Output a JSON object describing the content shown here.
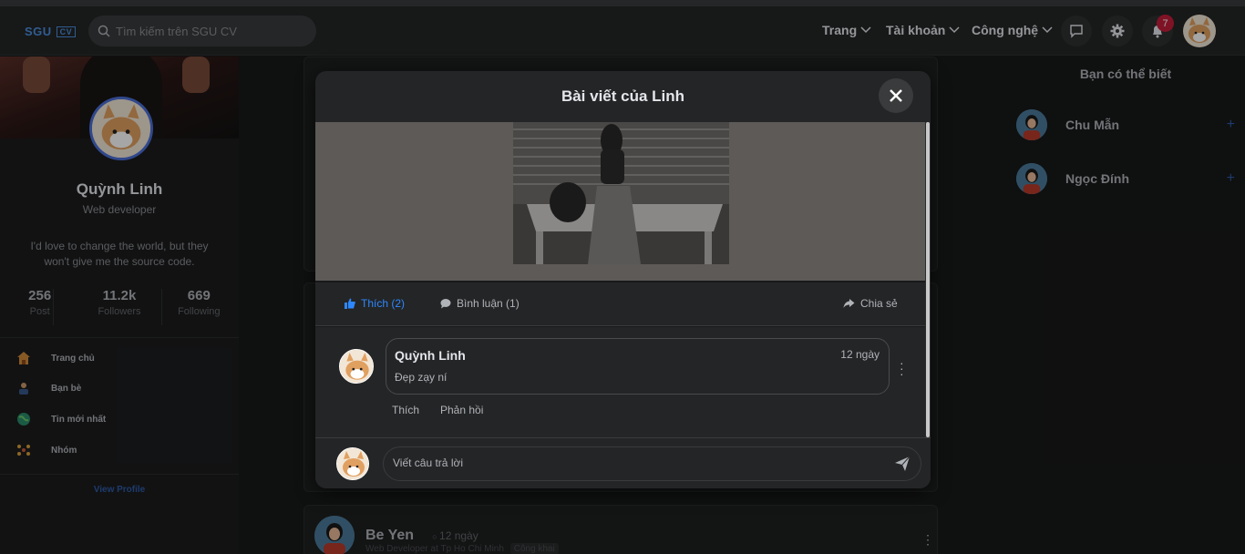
{
  "app": {
    "logo_main": "SGU",
    "logo_badge": "CV"
  },
  "search": {
    "placeholder": "Tìm kiếm trên SGU CV"
  },
  "nav": {
    "menus": [
      {
        "label": "Trang"
      },
      {
        "label": "Tài khoản"
      },
      {
        "label": "Công nghệ"
      }
    ],
    "notification_count": "7"
  },
  "profile": {
    "name": "Quỳnh Linh",
    "role": "Web developer",
    "bio": "I'd love to change the world, but they won't give me the source code.",
    "stats": [
      {
        "value": "256",
        "label": "Post"
      },
      {
        "value": "11.2k",
        "label": "Followers"
      },
      {
        "value": "669",
        "label": "Following"
      }
    ],
    "menu": [
      {
        "label": "Trang chủ",
        "icon": "home-icon"
      },
      {
        "label": "Bạn bè",
        "icon": "friends-icon"
      },
      {
        "label": "Tin mới nhất",
        "icon": "globe-icon"
      },
      {
        "label": "Nhóm",
        "icon": "group-icon"
      }
    ],
    "view_profile": "View Profile"
  },
  "modal": {
    "title": "Bài viết của Linh",
    "actions": {
      "like": "Thích (2)",
      "comment": "Bình luận (1)",
      "share": "Chia sẻ"
    },
    "comment": {
      "author": "Quỳnh Linh",
      "time": "12 ngày",
      "text": "Đẹp zạy ní",
      "like": "Thích",
      "reply": "Phản hồi"
    },
    "reply_placeholder": "Viết câu trả lời"
  },
  "feed_post": {
    "author": "Be Yen",
    "time": "12 ngày",
    "meta": "Web Developer at Tp Ho Chi Minh",
    "privacy": "Công khai"
  },
  "suggestions": {
    "title": "Bạn có thể biết",
    "people": [
      {
        "name": "Chu Mẫn"
      },
      {
        "name": "Ngọc Đính"
      }
    ]
  },
  "colors": {
    "accent": "#2d88ff",
    "badge": "#c41e3a",
    "background": "#18191a"
  }
}
